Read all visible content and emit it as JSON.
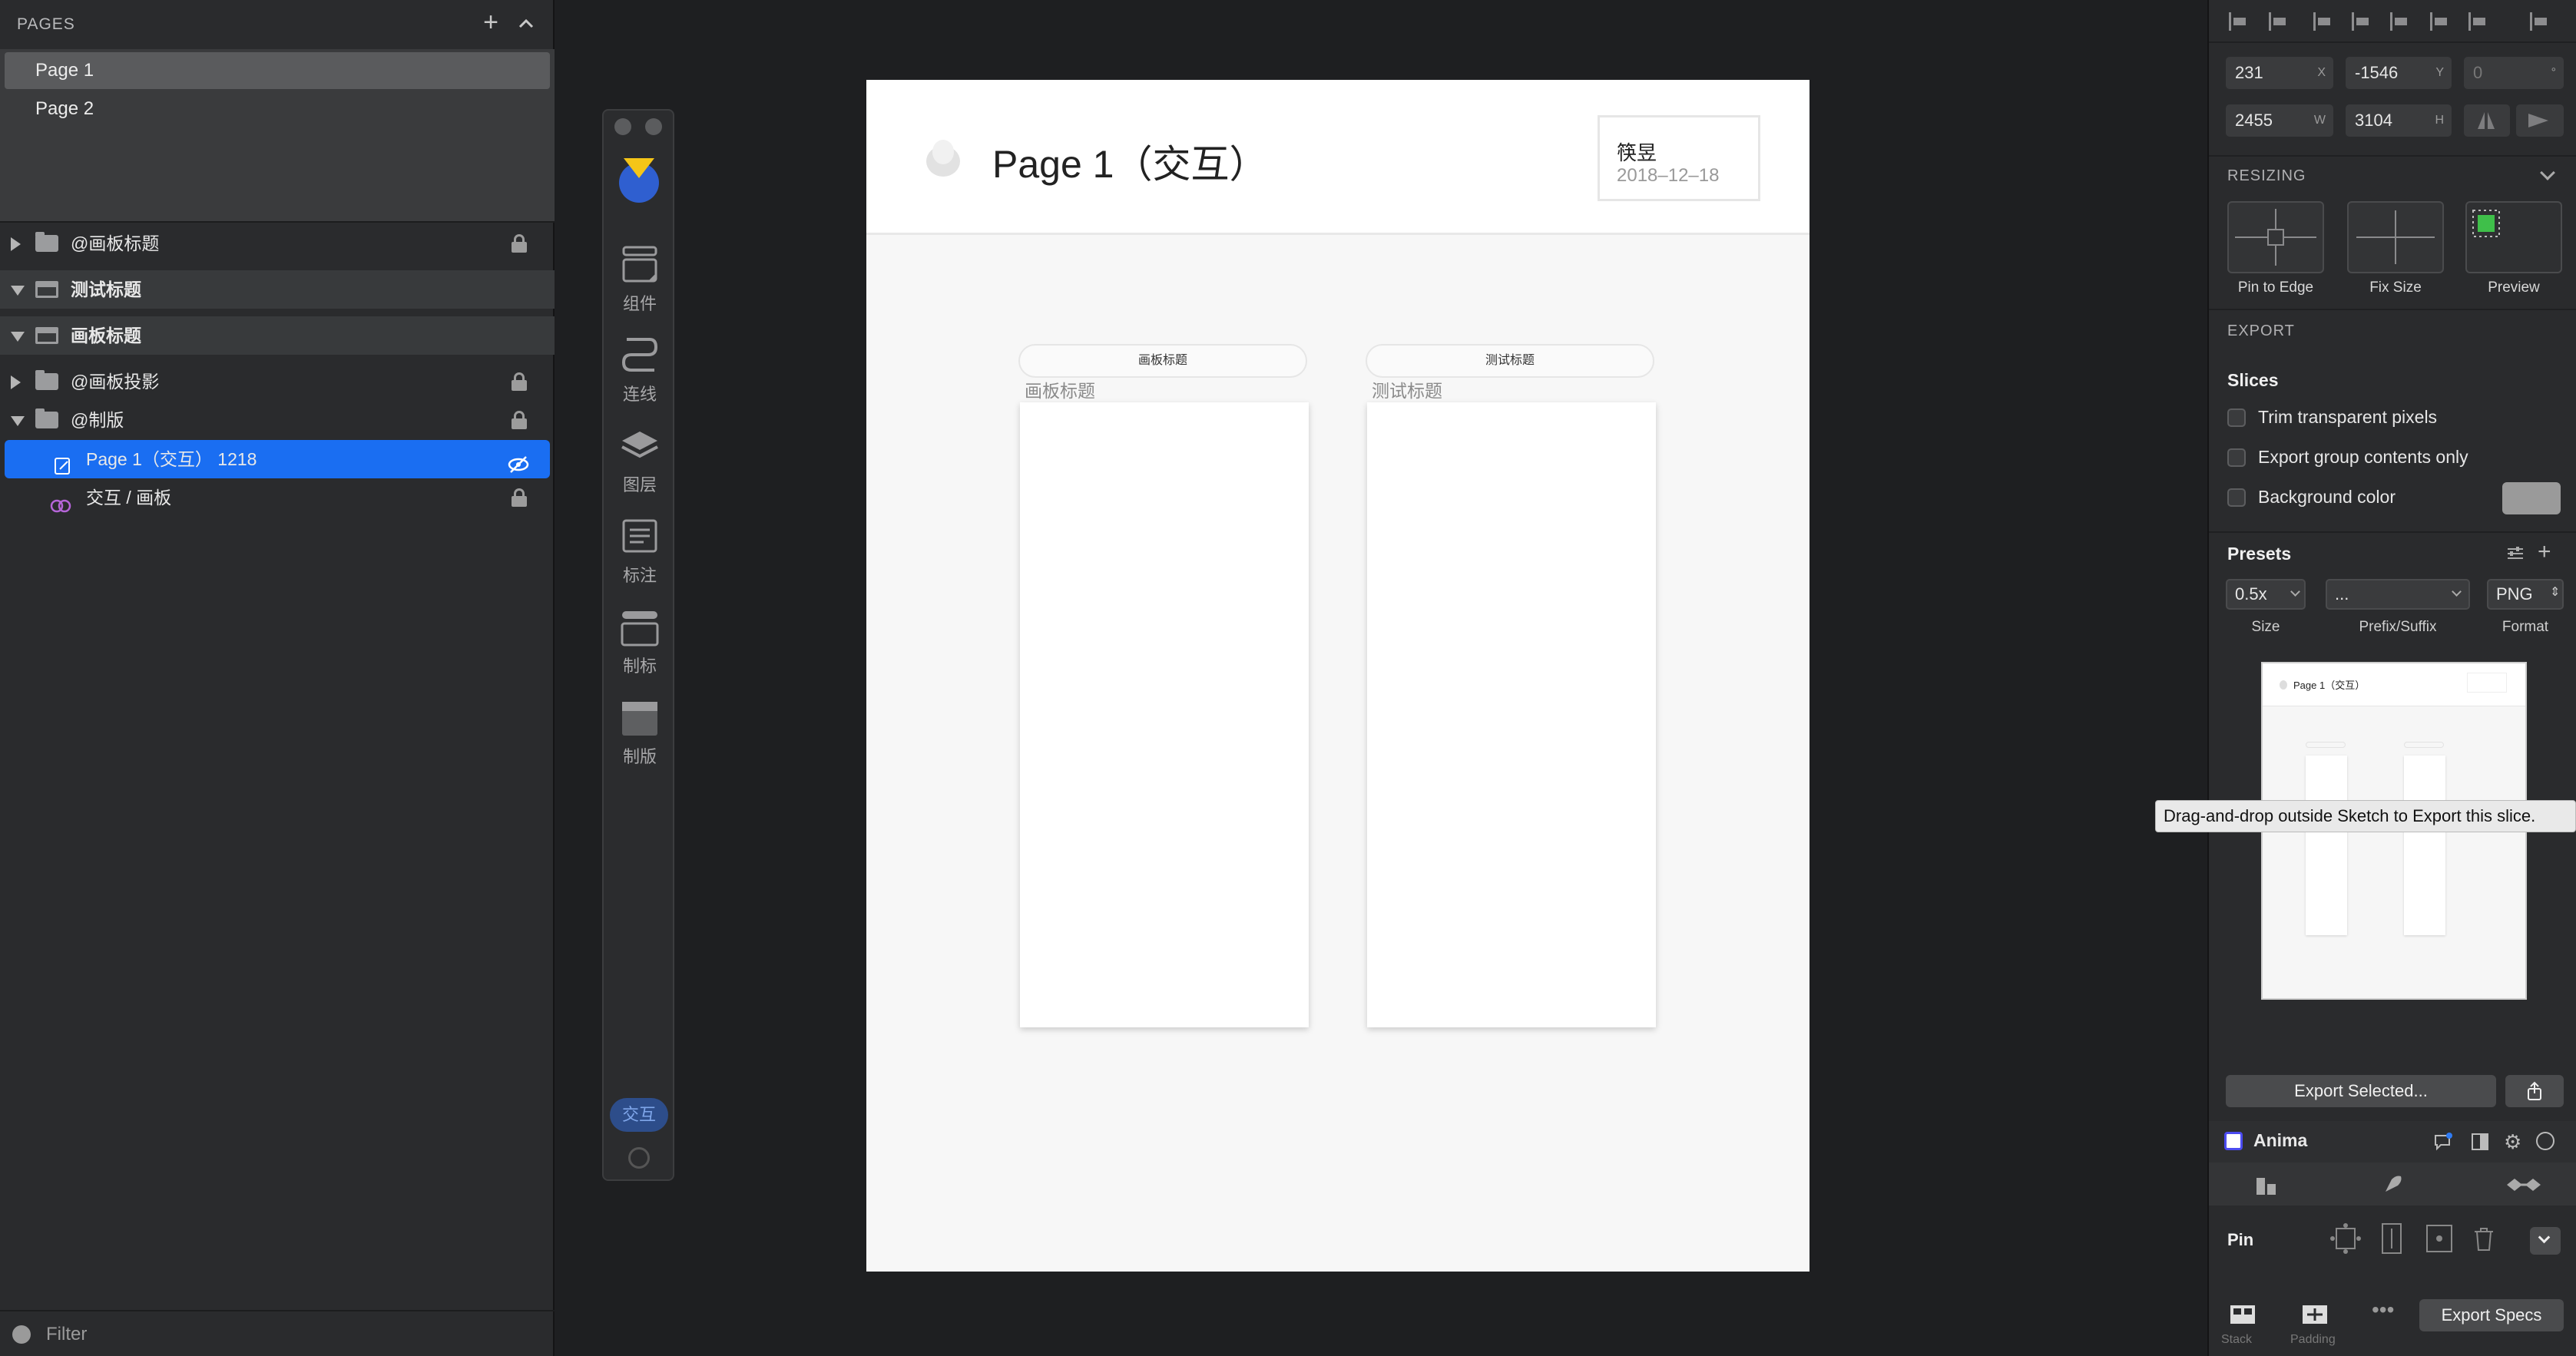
{
  "pages_panel": {
    "title": "PAGES",
    "pages": [
      {
        "label": "Page 1",
        "selected": true
      },
      {
        "label": "Page 2",
        "selected": false
      }
    ]
  },
  "layers": [
    {
      "label": "@画板标题",
      "kind": "folder",
      "expanded": false,
      "locked": true,
      "selected": false
    },
    {
      "label": "测试标题",
      "kind": "artboard",
      "expanded": true,
      "locked": false,
      "selected": false
    },
    {
      "label": "画板标题",
      "kind": "artboard",
      "expanded": true,
      "locked": false,
      "selected": false
    },
    {
      "label": "@画板投影",
      "kind": "folder",
      "expanded": false,
      "locked": true,
      "selected": false
    },
    {
      "label": "@制版",
      "kind": "folder",
      "expanded": true,
      "locked": true,
      "selected": false
    },
    {
      "label": "Page 1（交互）  1218",
      "kind": "text",
      "expanded": false,
      "locked": false,
      "selected": true
    },
    {
      "label": "交互 / 画板",
      "kind": "link",
      "expanded": false,
      "locked": true,
      "selected": false
    }
  ],
  "filter": {
    "label": "Filter"
  },
  "plugin_toolbar": {
    "items": [
      {
        "label": "组件",
        "icon": "component-icon"
      },
      {
        "label": "连线",
        "icon": "connect-line-icon"
      },
      {
        "label": "图层",
        "icon": "layers-icon"
      },
      {
        "label": "标注",
        "icon": "annotate-icon"
      },
      {
        "label": "制标",
        "icon": "make-title-icon"
      },
      {
        "label": "制版",
        "icon": "make-board-icon"
      }
    ],
    "mode_pill": "交互"
  },
  "artboard": {
    "title": "Page 1（交互）",
    "author": "筷昱",
    "date": "2018–12–18",
    "boards": [
      {
        "tab": "画板标题",
        "label": "画板标题"
      },
      {
        "tab": "测试标题",
        "label": "测试标题"
      }
    ]
  },
  "inspector": {
    "x": "231",
    "x_sfx": "X",
    "y": "-1546",
    "y_sfx": "Y",
    "rotation": "0",
    "rotation_sfx": "°",
    "w": "2455",
    "w_sfx": "W",
    "h": "3104",
    "h_sfx": "H",
    "resizing_title": "RESIZING",
    "resizing_options": [
      "Pin to Edge",
      "Fix Size",
      "Preview"
    ],
    "export_title": "EXPORT",
    "slices_title": "Slices",
    "slice_options": [
      "Trim transparent pixels",
      "Export group contents only",
      "Background color"
    ],
    "presets_title": "Presets",
    "preset": {
      "size": "0.5x",
      "prefix": "...",
      "format": "PNG"
    },
    "preset_captions": [
      "Size",
      "Prefix/Suffix",
      "Format"
    ],
    "preview": {
      "title": "Page 1（交互）"
    },
    "tooltip": "Drag-and-drop outside Sketch to Export this slice.",
    "export_button": "Export Selected...",
    "anima_title": "Anima",
    "pin_label": "Pin",
    "bottom": {
      "stack": "Stack",
      "padding": "Padding",
      "export_specs": "Export Specs"
    }
  },
  "colors": {
    "selection": "#1a6ef2",
    "accent_green": "#3fbf4a",
    "logo_yellow": "#f5c518",
    "logo_blue": "#2f5fd0"
  }
}
